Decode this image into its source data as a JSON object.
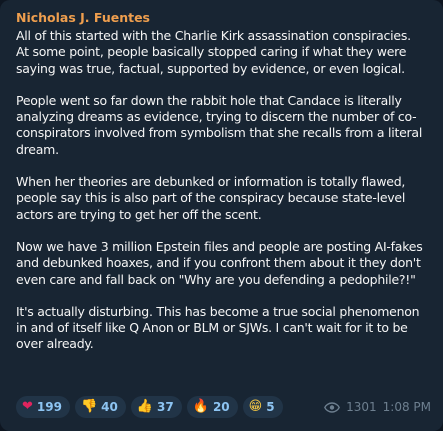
{
  "message": {
    "author": "Nicholas J. Fuentes",
    "paragraphs": [
      {
        "lines": [
          "All of this started with the Charlie Kirk assassination conspiracies.",
          "At some point, people basically stopped caring if what they were",
          "saying was true, factual, supported by evidence, or even logical."
        ]
      },
      {
        "lines": [
          "People went so far down the rabbit hole that Candace is literally",
          "analyzing dreams as evidence, trying to discern the number of co-",
          "conspirators involved from symbolism that she recalls from a literal",
          "dream."
        ]
      },
      {
        "lines": [
          "When her theories are debunked or information is totally flawed,",
          "people say this is also part of the conspiracy because state-level",
          "actors are trying to get her off the scent."
        ]
      },
      {
        "lines": [
          "Now we have 3 million Epstein files and people are posting AI-fakes",
          "and debunked hoaxes, and if you confront them about it they don't",
          "even care and fall back on \"Why are you defending a pedophile?!\""
        ]
      },
      {
        "lines": [
          "It's actually disturbing. This has become a true social phenomenon",
          "in and of itself like Q Anon or BLM or SJWs. I can't wait for it to be",
          "over already."
        ]
      }
    ],
    "reactions": [
      {
        "emoji": "❤",
        "icon": "heart-icon",
        "count": "199"
      },
      {
        "emoji": "👎",
        "icon": "thumbs-down-icon",
        "count": "40"
      },
      {
        "emoji": "👍",
        "icon": "thumbs-up-icon",
        "count": "37"
      },
      {
        "emoji": "🔥",
        "icon": "fire-icon",
        "count": "20"
      },
      {
        "emoji": "😁",
        "icon": "grinning-face-icon",
        "count": "5"
      }
    ],
    "views": "1301",
    "time": "1:08 PM",
    "colors": {
      "author": "#ee9e4e",
      "bubble": "#182533",
      "reaction_count": "#8dc4f2",
      "meta": "#6d7f8f"
    }
  }
}
